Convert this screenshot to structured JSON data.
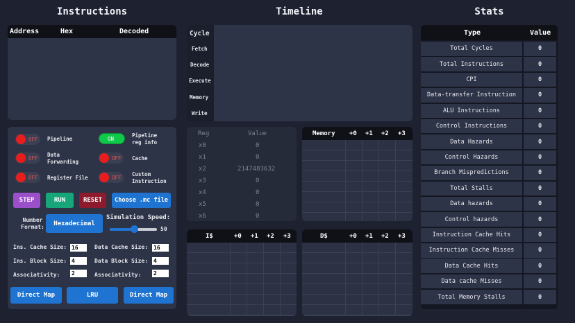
{
  "headers": {
    "instructions": "Instructions",
    "timeline": "Timeline",
    "stats": "Stats"
  },
  "instr_table": {
    "address": "Address",
    "hex": "Hex",
    "decoded": "Decoded"
  },
  "toggles": [
    {
      "label": "Pipeline",
      "state": "OFF"
    },
    {
      "label": "Pipeline reg info",
      "state": "ON"
    },
    {
      "label": "Data Forwarding",
      "state": "OFF"
    },
    {
      "label": "Cache",
      "state": "OFF"
    },
    {
      "label": "Register File",
      "state": "OFF"
    },
    {
      "label": "Custom Instruction",
      "state": "OFF"
    }
  ],
  "buttons": {
    "step": "STEP",
    "run": "RUN",
    "reset": "RESET",
    "choose": "Choose .mc file"
  },
  "number_format": {
    "label": "Number Format:",
    "value": "Hexadecimal"
  },
  "sim_speed": {
    "label": "Simulation Speed:",
    "value": "50"
  },
  "cache_cfg": {
    "ins_cache_size": {
      "label": "Ins. Cache Size:",
      "value": "16"
    },
    "data_cache_size": {
      "label": "Data Cache Size:",
      "value": "16"
    },
    "ins_block_size": {
      "label": "Ins. Block Size:",
      "value": "4"
    },
    "data_block_size": {
      "label": "Data Block Size:",
      "value": "4"
    },
    "assoc_ins": {
      "label": "Associativity:",
      "value": "2"
    },
    "assoc_data": {
      "label": "Associativity:",
      "value": "2"
    }
  },
  "policy_buttons": [
    "Direct Map",
    "LRU",
    "Direct Map"
  ],
  "timeline_rows": [
    "Cycle",
    "Fetch",
    "Decode",
    "Execute",
    "Memory",
    "Write"
  ],
  "registers": {
    "head": [
      "Reg",
      "Value"
    ],
    "rows": [
      [
        "x0",
        "0"
      ],
      [
        "x1",
        "0"
      ],
      [
        "x2",
        "2147483632"
      ],
      [
        "x3",
        "0"
      ],
      [
        "x4",
        "0"
      ],
      [
        "x5",
        "0"
      ],
      [
        "x6",
        "0"
      ]
    ]
  },
  "memory_head": [
    "Memory",
    "+0",
    "+1",
    "+2",
    "+3"
  ],
  "icache_head": [
    "I$",
    "+0",
    "+1",
    "+2",
    "+3"
  ],
  "dcache_head": [
    "D$",
    "+0",
    "+1",
    "+2",
    "+3"
  ],
  "stats": {
    "head": [
      "Type",
      "Value"
    ],
    "rows": [
      [
        "Total Cycles",
        "0"
      ],
      [
        "Total Instructions",
        "0"
      ],
      [
        "CPI",
        "0"
      ],
      [
        "Data-transfer Instruction",
        "0"
      ],
      [
        "ALU Instructions",
        "0"
      ],
      [
        "Control Instructions",
        "0"
      ],
      [
        "Data Hazards",
        "0"
      ],
      [
        "Control Hazards",
        "0"
      ],
      [
        "Branch Mispredictions",
        "0"
      ],
      [
        "Total Stalls",
        "0"
      ],
      [
        "Data hazards",
        "0"
      ],
      [
        "Control hazards",
        "0"
      ],
      [
        "Instruction Cache Hits",
        "0"
      ],
      [
        "Instruction Cache Misses",
        "0"
      ],
      [
        "Data Cache Hits",
        "0"
      ],
      [
        "Data cache Misses",
        "0"
      ],
      [
        "Total Memory Stalls",
        "0"
      ]
    ]
  },
  "colors": {
    "step": "#9b4fc9",
    "run": "#17a67a",
    "reset": "#8d1a2d",
    "blue": "#1f74d1",
    "on": "#10c94a",
    "off": "#e81e1e"
  }
}
